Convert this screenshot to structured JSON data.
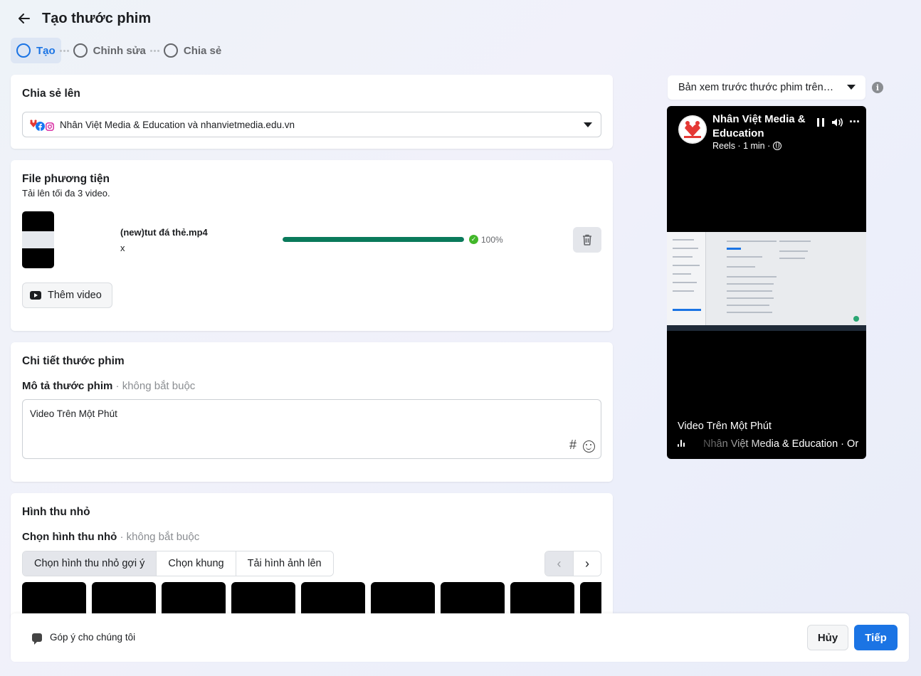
{
  "header": {
    "title": "Tạo thước phim",
    "back_icon": "arrow-left-icon",
    "steps": [
      {
        "label": "Tạo",
        "active": true
      },
      {
        "label": "Chỉnh sửa",
        "active": false
      },
      {
        "label": "Chia sẻ",
        "active": false
      }
    ]
  },
  "share": {
    "title": "Chia sẻ lên",
    "selected_value": "Nhân Việt Media & Education và nhanvietmedia.edu.vn",
    "icons": [
      "page-logo-icon",
      "facebook-icon",
      "instagram-icon"
    ]
  },
  "media": {
    "title": "File phương tiện",
    "subtitle": "Tải lên tối đa 3 video.",
    "file": {
      "name": "(new)tut đá thẻ.mp4",
      "secondary": "x",
      "progress": 1.0,
      "progress_label": "100%"
    },
    "add_video_label": "Thêm video"
  },
  "details": {
    "title": "Chi tiết thước phim",
    "description_label": "Mô tả thước phim",
    "optional_label": "không bắt buộc",
    "description_value": "Video Trên Một Phút"
  },
  "thumbnail": {
    "title": "Hình thu nhỏ",
    "choose_label": "Chọn hình thu nhỏ",
    "optional_label": "không bắt buộc",
    "tabs": [
      {
        "label": "Chọn hình thu nhỏ gợi ý",
        "active": true
      },
      {
        "label": "Chọn khung",
        "active": false
      },
      {
        "label": "Tải hình ảnh lên",
        "active": false
      }
    ],
    "tile_count": 9
  },
  "footer": {
    "feedback_label": "Góp ý cho chúng tôi",
    "cancel_label": "Hủy",
    "next_label": "Tiếp"
  },
  "preview": {
    "select_value": "Bản xem trước thước phim trên Facebook",
    "page_name": "Nhân Việt Media & Education",
    "meta": "Reels · 1 min ·",
    "caption": "Video Trên Một Phút",
    "audio": "Nhân Việt Media & Education · Or"
  },
  "colors": {
    "accent": "#1b74e4",
    "progress": "#0a7a5b",
    "success": "#42b72a"
  }
}
